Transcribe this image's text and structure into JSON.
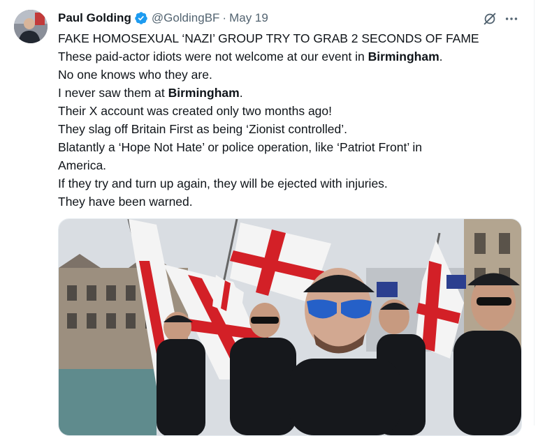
{
  "tweet": {
    "author": {
      "display_name": "Paul Golding",
      "handle": "@GoldingBF",
      "verified_icon": "verified-badge-icon",
      "avatar_icon": "profile-avatar"
    },
    "separator": "·",
    "date": "May 19",
    "actions": {
      "grok_icon": "grok-icon",
      "more_icon": "more-dots-icon"
    },
    "body": {
      "line1": "FAKE HOMOSEXUAL ‘NAZI’ GROUP TRY TO GRAB 2 SECONDS OF FAME",
      "line2_pre": "These paid-actor idiots were not welcome at our event in ",
      "line2_bold": "Birmingham",
      "line2_post": ".",
      "line3": "No one knows who they are.",
      "line4_pre": "I never saw them at ",
      "line4_bold": "Birmingham",
      "line4_post": ".",
      "line5": "Their X account was created only two months ago!",
      "line6": "They slag off Britain First as being ‘Zionist controlled’.",
      "line7": "Blatantly a ‘Hope Not Hate’ or police operation, like ‘Patriot Front’ in",
      "line8": "America.",
      "line9": "If they try and turn up again, they will be ejected with injuries.",
      "line10": "They have been warned."
    },
    "media": {
      "kind": "photo",
      "content": "crowd-with-st-george-flags"
    }
  },
  "colors": {
    "text_primary": "#0f1419",
    "text_secondary": "#536471",
    "verified_blue": "#1d9bf0",
    "divider": "#eff3f4"
  }
}
